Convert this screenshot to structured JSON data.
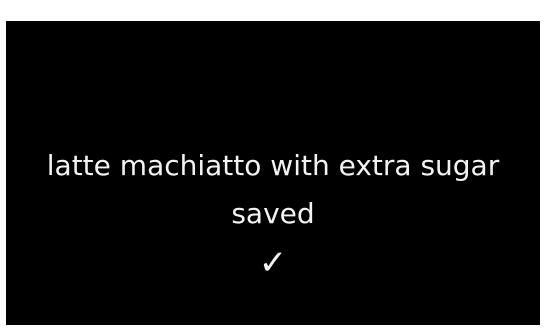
{
  "confirmation": {
    "line1": "latte machiatto with extra sugar",
    "line2": "saved",
    "check_glyph": "✓",
    "icon": "checkmark-icon"
  },
  "colors": {
    "screen_background": "#000000",
    "text": "#f2f2f2",
    "page_background": "#ffffff"
  }
}
